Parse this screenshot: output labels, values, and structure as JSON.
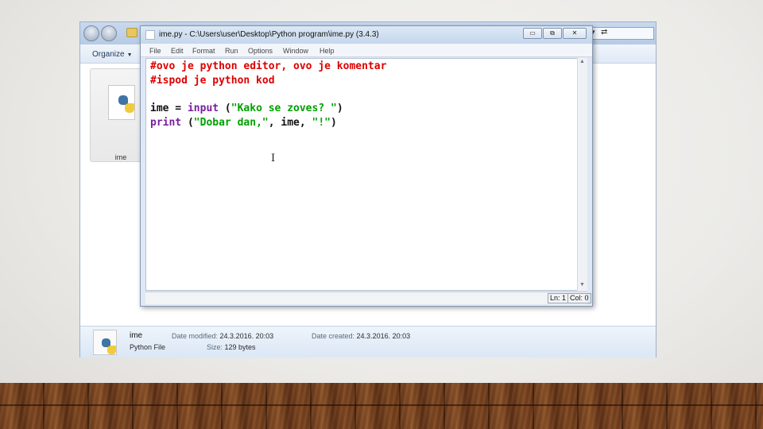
{
  "explorer": {
    "toolbar": {
      "organize_label": "Organize",
      "organize_caret": "▼"
    },
    "file_tile": {
      "name": "ime",
      "icon": "python-file-icon"
    },
    "address_dropdown": "▾",
    "refresh_icon": "⇄",
    "details": {
      "name": "ime",
      "type": "Python File",
      "date_modified_label": "Date modified:",
      "date_modified": "24.3.2016. 20:03",
      "size_label": "Size:",
      "size": "129 bytes",
      "date_created_label": "Date created:",
      "date_created": "24.3.2016. 20:03"
    }
  },
  "idle": {
    "title": "ime.py - C:\\Users\\user\\Desktop\\Python program\\ime.py (3.4.3)",
    "window_buttons": {
      "minimize": "▭",
      "maximize": "⧉",
      "close": "✕"
    },
    "menu": [
      "File",
      "Edit",
      "Format",
      "Run",
      "Options",
      "Window",
      "Help"
    ],
    "code": {
      "line1": "#ovo je python editor, ovo je komentar",
      "line2": "#ispod je python kod",
      "line4": {
        "var": "ime = ",
        "func": "input",
        "open": " (",
        "str": "\"Kako se zoves? \"",
        "close": ")"
      },
      "line5": {
        "func": "print",
        "open": " (",
        "str1": "\"Dobar dan,\"",
        "mid": ", ime, ",
        "str2": "\"!\"",
        "close": ")"
      }
    },
    "status": {
      "line": "Ln: 1",
      "col": "Col: 0"
    },
    "scroll_up": "▲",
    "scroll_down": "▼",
    "cursor": "I"
  },
  "colors": {
    "comment": "#dd0000",
    "keyword": "#7a1ea0",
    "string": "#00a000"
  }
}
